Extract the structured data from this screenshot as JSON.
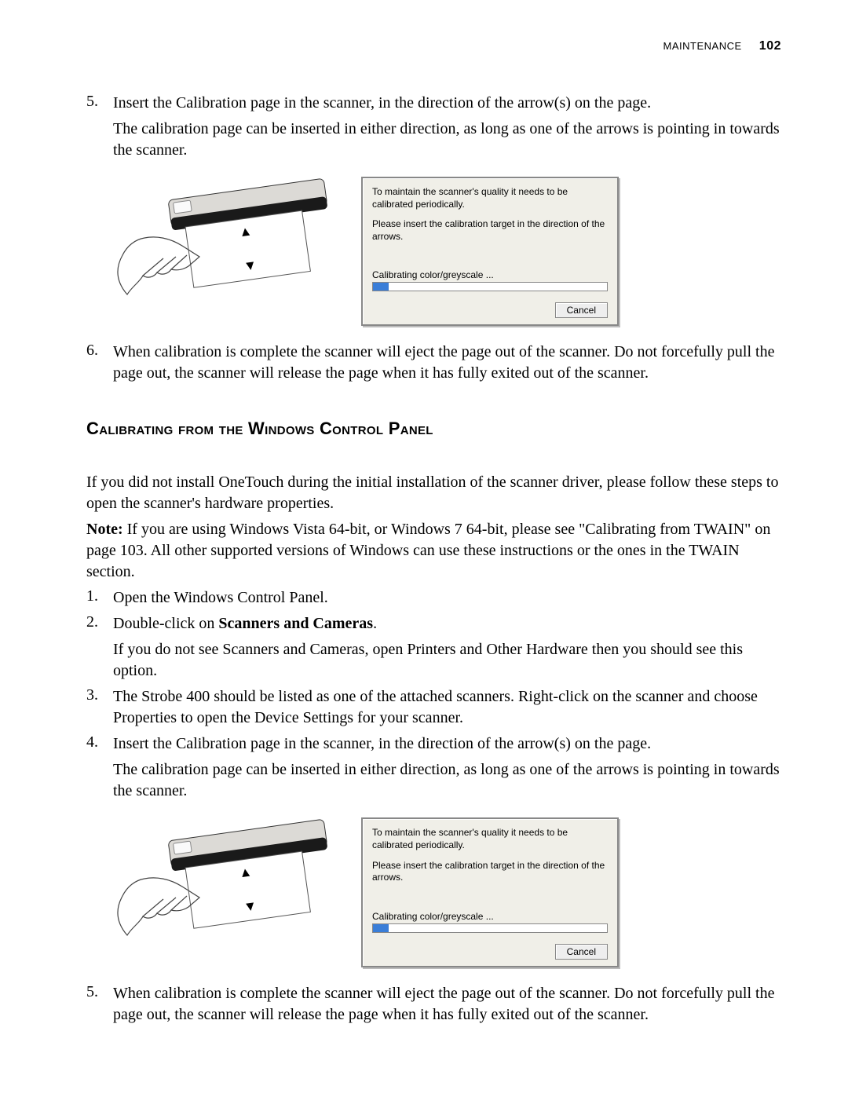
{
  "header": {
    "section": "Maintenance",
    "page_number": "102"
  },
  "top_list": {
    "item5": {
      "num": "5.",
      "line1": "Insert the Calibration page in the scanner, in the direction of the arrow(s) on the page.",
      "line2": "The calibration page can be inserted in either direction, as long as one of the arrows is pointing in towards the scanner."
    },
    "item6": {
      "num": "6.",
      "text": "When calibration is complete the scanner will eject the page out of the scanner. Do not forcefully pull the page out, the scanner will release the page when it has fully exited out of the scanner."
    }
  },
  "dialog": {
    "line1": "To maintain the scanner's quality it needs to be calibrated periodically.",
    "line2": "Please insert the calibration target in the direction of the arrows.",
    "status": "Calibrating color/greyscale ...",
    "cancel": "Cancel"
  },
  "subhead": "Calibrating from the Windows Control Panel",
  "intro": "If you did not install OneTouch during the initial installation of the scanner driver, please follow these steps to open the scanner's hardware properties.",
  "note_label": "Note:",
  "note_text": " If you are using Windows Vista 64-bit, or Windows 7 64-bit, please see \"Calibrating from TWAIN\" on page 103. All other supported versions of Windows can use these instructions or the ones in the TWAIN section.",
  "steps": {
    "s1": {
      "num": "1.",
      "text": "Open the Windows Control Panel."
    },
    "s2": {
      "num": "2.",
      "pre": "Double-click on ",
      "bold": "Scanners and Cameras",
      "post": ".",
      "sub": "If you do not see Scanners and Cameras, open Printers and Other Hardware then you should see this option."
    },
    "s3": {
      "num": "3.",
      "text": "The Strobe 400 should be listed as one of the attached scanners. Right-click on the scanner and choose Properties to open the Device Settings for your scanner."
    },
    "s4": {
      "num": "4.",
      "line1": "Insert the Calibration page in the scanner, in the direction of the arrow(s) on the page.",
      "line2": "The calibration page can be inserted in either direction, as long as one of the arrows is pointing in towards the scanner."
    },
    "s5": {
      "num": "5.",
      "text": "When calibration is complete the scanner will eject the page out of the scanner. Do not forcefully pull the page out, the scanner will release the page when it has fully exited out of the scanner."
    }
  }
}
